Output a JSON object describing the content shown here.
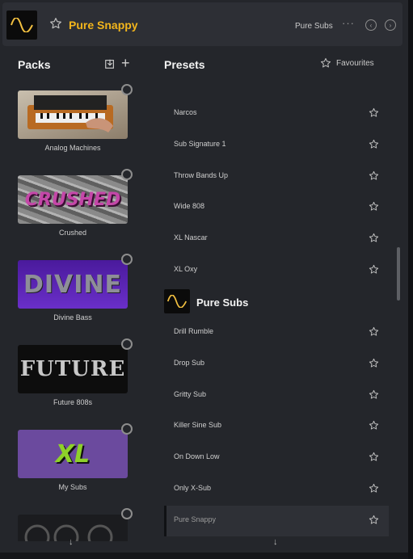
{
  "header": {
    "preset_title": "Pure Snappy",
    "current_pack": "Pure Subs",
    "more_glyph": "···",
    "prev_glyph": "‹",
    "next_glyph": "›"
  },
  "packs_panel": {
    "title": "Packs",
    "add_glyph": "+",
    "items": [
      {
        "label": "Analog Machines",
        "thumb_text": ""
      },
      {
        "label": "Crushed",
        "thumb_text": "CRUSHED"
      },
      {
        "label": "Divine Bass",
        "thumb_text": "DIVINE"
      },
      {
        "label": "Future 808s",
        "thumb_text": "FUTURE"
      },
      {
        "label": "My Subs",
        "thumb_text": "XL"
      },
      {
        "label": "",
        "thumb_text": ""
      }
    ],
    "scroll_glyph": "↓"
  },
  "presets_panel": {
    "title": "Presets",
    "favourites_label": "Favourites",
    "presets_before": [
      "Narcos",
      "Sub Signature 1",
      "Throw Bands Up",
      "Wide 808",
      "XL Nascar",
      "XL Oxy"
    ],
    "section_title": "Pure Subs",
    "presets_after": [
      "Drill Rumble",
      "Drop Sub",
      "Gritty Sub",
      "Killer Sine Sub",
      "On Down Low",
      "Only X-Sub",
      "Pure Snappy"
    ],
    "selected_preset": "Pure Snappy",
    "scroll_glyph": "↓"
  },
  "colors": {
    "accent": "#f2b51c",
    "panel": "#24262b",
    "header": "#2d2f35"
  }
}
